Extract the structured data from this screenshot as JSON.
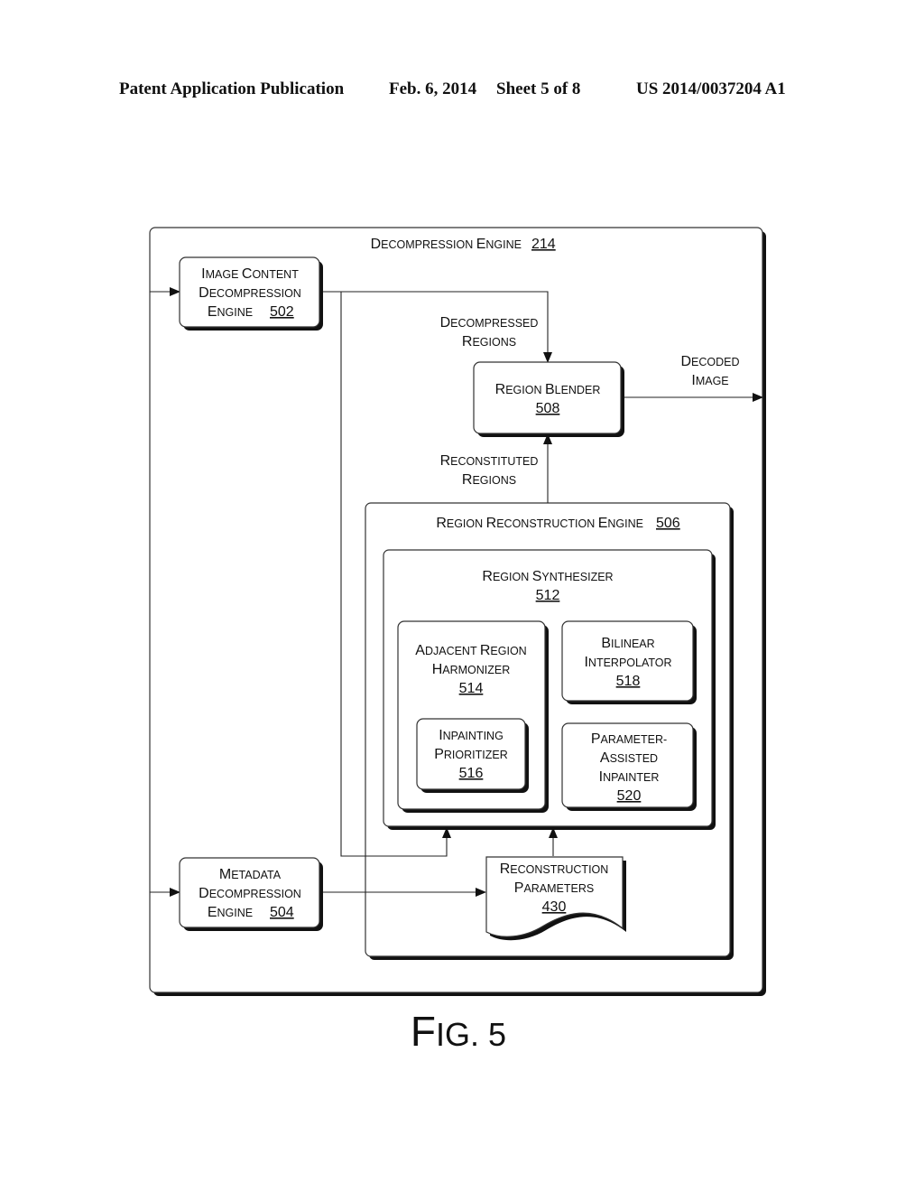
{
  "header": {
    "publication": "Patent Application Publication",
    "date": "Feb. 6, 2014",
    "sheet": "Sheet 5 of 8",
    "number": "US 2014/0037204 A1"
  },
  "diagram": {
    "outer": {
      "title": "Decompression Engine",
      "ref": "214"
    },
    "image_content_engine": {
      "lines": [
        "Image Content",
        "Decompression",
        "Engine"
      ],
      "ref": "502"
    },
    "metadata_engine": {
      "lines": [
        "Metadata",
        "Decompression",
        "Engine"
      ],
      "ref": "504"
    },
    "region_blender": {
      "lines": [
        "Region Blender"
      ],
      "ref": "508"
    },
    "reconstruction_engine": {
      "title": "Region Reconstruction Engine",
      "ref": "506"
    },
    "region_synthesizer": {
      "lines": [
        "Region Synthesizer"
      ],
      "ref": "512"
    },
    "harmonizer": {
      "lines": [
        "Adjacent Region",
        "Harmonizer"
      ],
      "ref": "514"
    },
    "prioritizer": {
      "lines": [
        "Inpainting",
        "Prioritizer"
      ],
      "ref": "516"
    },
    "interpolator": {
      "lines": [
        "Bilinear",
        "Interpolator"
      ],
      "ref": "518"
    },
    "inpainter": {
      "lines": [
        "Parameter-",
        "Assisted",
        "Inpainter"
      ],
      "ref": "520"
    },
    "parameters": {
      "lines": [
        "Reconstruction",
        "Parameters"
      ],
      "ref": "430"
    },
    "edge_labels": {
      "decompressed_regions": [
        "Decompressed",
        "Regions"
      ],
      "decoded_image": [
        "Decoded",
        "Image"
      ],
      "reconstituted_regions": [
        "Reconstituted",
        "Regions"
      ]
    }
  },
  "figure_caption": "Fig. 5"
}
